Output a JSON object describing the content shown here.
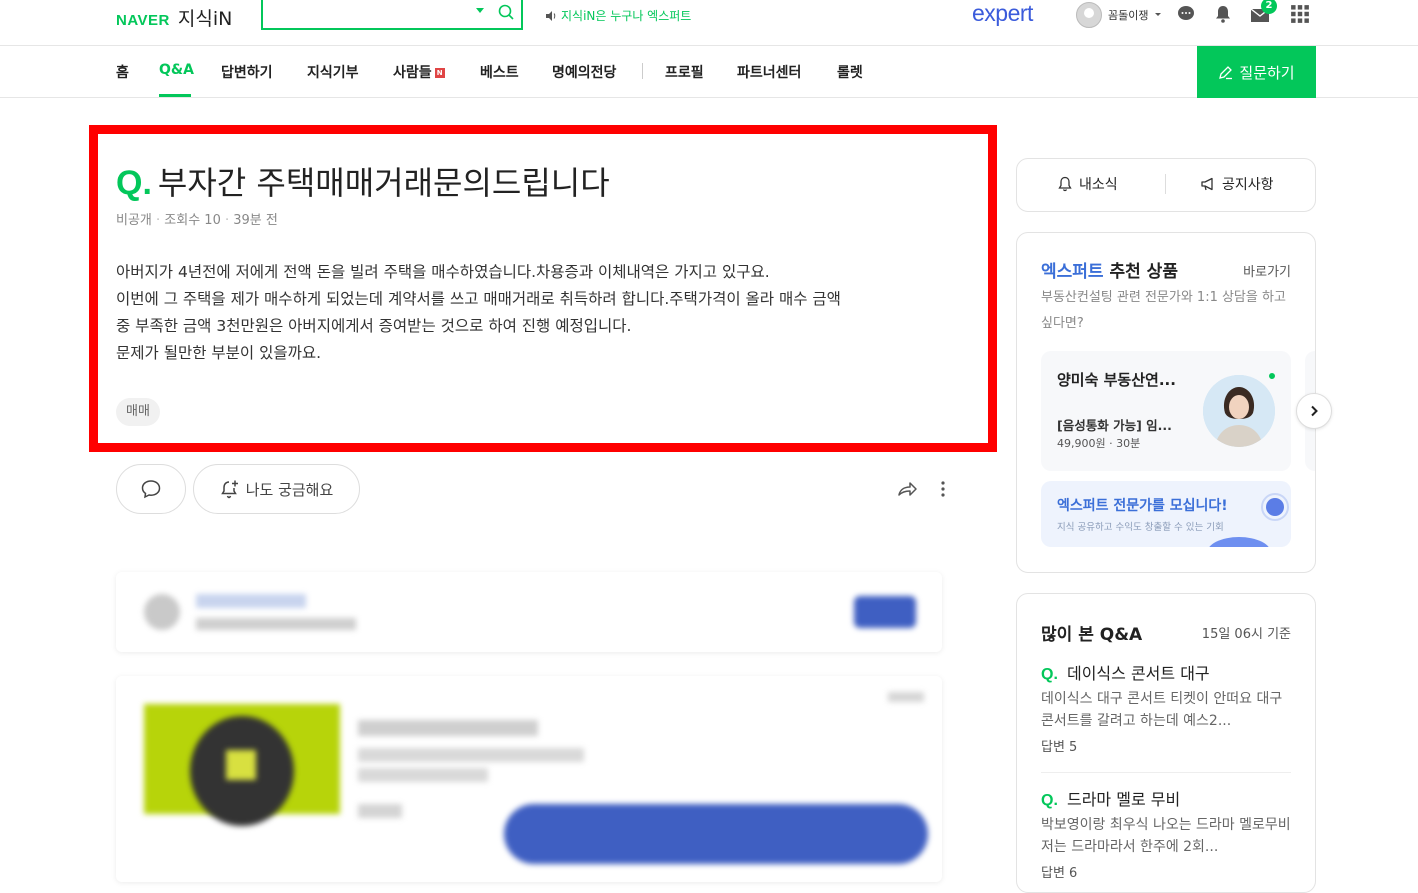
{
  "header": {
    "logo_naver": "NAVER",
    "logo_service": "지식iN",
    "search_placeholder": "",
    "notice": "지식iN은 누구나 엑스퍼트",
    "expert_logo": "expert",
    "user_name": "꼼돌이쟁",
    "mail_count": "2"
  },
  "gnb": {
    "items": [
      "홈",
      "Q&A",
      "답변하기",
      "지식기부",
      "사람들",
      "베스트",
      "명예의전당",
      "프로필",
      "파트너센터",
      "롤렛"
    ],
    "new_badge": "N",
    "active_index": 1,
    "ask_button": "질문하기"
  },
  "question": {
    "q_mark": "Q.",
    "title": "부자간 주택매매거래문의드립니다",
    "author": "비공개",
    "views": "조회수 10",
    "time": "39분 전",
    "body_lines": [
      "아버지가 4년전에 저에게 전액 돈을 빌려 주택을 매수하였습니다.차용증과 이체내역은 가지고 있구요.",
      "이번에 그 주택을 제가 매수하게 되었는데 계약서를 쓰고 매매거래로 취득하려 합니다.주택가격이 올라 매수 금액",
      "중 부족한 금액 3천만원은 아버지에게서 증여받는 것으로 하여 진행 예정입니다.",
      "문제가 될만한 부분이 있을까요."
    ],
    "tag": "매매",
    "curious_button": "나도 궁금해요"
  },
  "sidebar": {
    "tab_news": "내소식",
    "tab_notice": "공지사항",
    "expert": {
      "title_blue": "엑스퍼트",
      "title_rest": "추천 상품",
      "go": "바로가기",
      "subtitle": "부동산컨설팅 관련 전문가와 1:1 상담을 하고 싶다면?",
      "card_name": "양미숙 부동산연...",
      "card_desc": "[음성통화 가능] 임...",
      "card_price": "49,900원 · 30분",
      "recruit_title": "엑스퍼트 전문가를 모십니다!",
      "recruit_sub": "지식 공유하고 수익도 창출할 수 있는 기회"
    },
    "popular": {
      "title": "많이 본 Q&A",
      "time": "15일 06시 기준",
      "items": [
        {
          "q": "Q.",
          "title": "데이식스 콘서트 대구",
          "body": "데이식스 대구 콘서트 티켓이 안떠요 대구 콘서트를 갈려고 하는데 예스2...",
          "answers": "답변 5"
        },
        {
          "q": "Q.",
          "title": "드라마 멜로 무비",
          "body": "박보영이랑 최우식 나오는 드라마 멜로무비 저는 드라마라서 한주에 2회...",
          "answers": "답변 6"
        }
      ]
    }
  },
  "colors": {
    "brand_green": "#03c75a",
    "expert_blue": "#3b5bdb",
    "highlight_red": "#ff0000"
  }
}
